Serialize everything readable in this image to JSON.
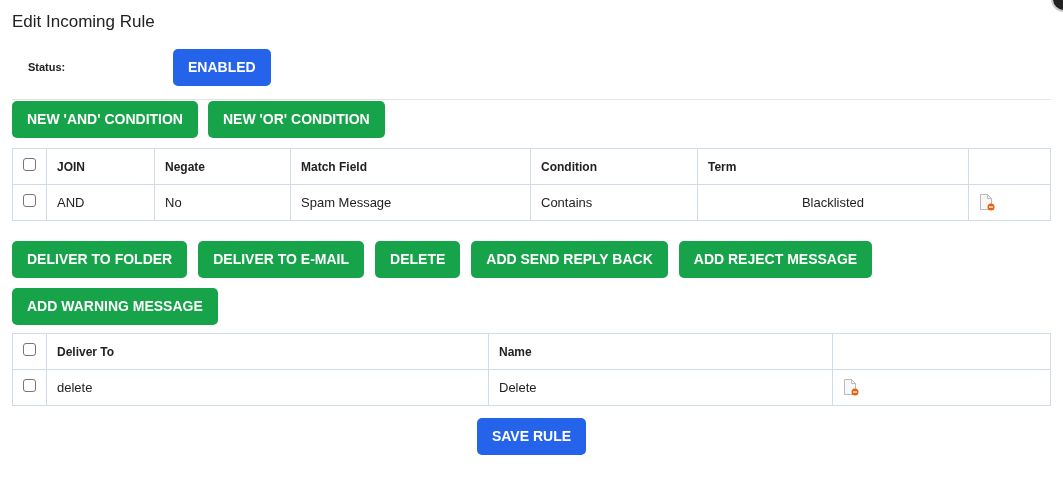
{
  "title": "Edit Incoming Rule",
  "status": {
    "label": "Status:",
    "button": "ENABLED"
  },
  "condition_buttons": [
    "NEW 'AND' CONDITION",
    "NEW 'OR' CONDITION"
  ],
  "conditions_table": {
    "columns": [
      "JOIN",
      "Negate",
      "Match Field",
      "Condition",
      "Term"
    ],
    "header_checked": false,
    "rows": [
      {
        "checked": false,
        "cells": [
          "AND",
          "No",
          "Spam Message",
          "Contains",
          "Blacklisted"
        ]
      }
    ]
  },
  "action_buttons": [
    "DELIVER TO FOLDER",
    "DELIVER TO E-MAIL",
    "DELETE",
    "ADD SEND REPLY BACK",
    "ADD REJECT MESSAGE",
    "ADD WARNING MESSAGE"
  ],
  "actions_table": {
    "columns": [
      "Deliver To",
      "Name"
    ],
    "header_checked": false,
    "rows": [
      {
        "checked": false,
        "cells": [
          "delete",
          "Delete"
        ]
      }
    ]
  },
  "save_button": "SAVE RULE"
}
